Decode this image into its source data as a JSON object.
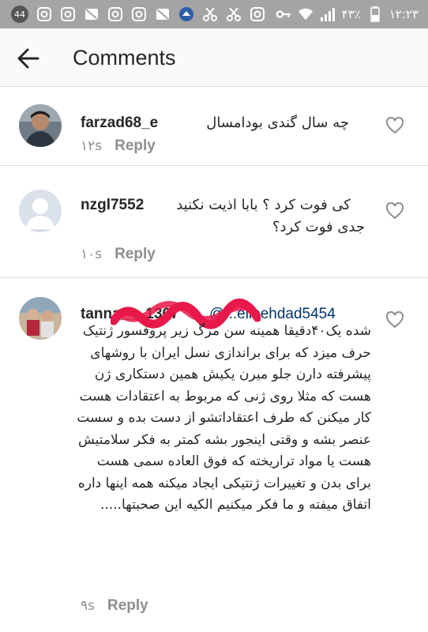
{
  "status_bar": {
    "notification_count": "44",
    "battery_percent": "۴۳٪",
    "time": "۱۲:۲۳"
  },
  "header": {
    "title": "Comments",
    "back_icon": "arrow-left-icon"
  },
  "comments": [
    {
      "username": "farzad68_e",
      "text": "چه سال گندی بودامسال",
      "time": "۱۲s",
      "reply_label": "Reply"
    },
    {
      "username": "nzgl7552",
      "text_line1": "کی فوت کرد ؟ بابا اذیت نکنید",
      "text_line2": "جدی فوت کرد؟",
      "time": "۱۰s",
      "reply_label": "Reply"
    },
    {
      "username": "tanna___1367",
      "mention": "@...elibehdad5454",
      "text": "شده یک۴۰دقیقا همینه سن مرگ زیر پروفسور ژنتیک حرف میزد که برای براندازی نسل ایران با روشهای پیشرفته دارن جلو میرن یکیش همین دستکاری ژن هست که مثلا روی ژنی که مربوط به اعتقادات هست کار میکنن که طرف اعتقاداتشو از دست بده و سست عنصر بشه و وقتی اینجور بشه کمتر به فکر سلامتیش هست یا مواد تراریخته که فوق العاده سمی هست برای بدن و تغییرات ژنتیکی ایجاد میکنه همه اینها داره اتفاق میفته و ما فکر میکنیم الکیه این صحبتها.....",
      "time": "۹s",
      "reply_label": "Reply"
    }
  ],
  "colors": {
    "status_bar_bg": "#a4a4a4",
    "text": "#262626",
    "secondary": "#8e8e8e",
    "mention": "#003569",
    "redaction": "#e8194a"
  }
}
